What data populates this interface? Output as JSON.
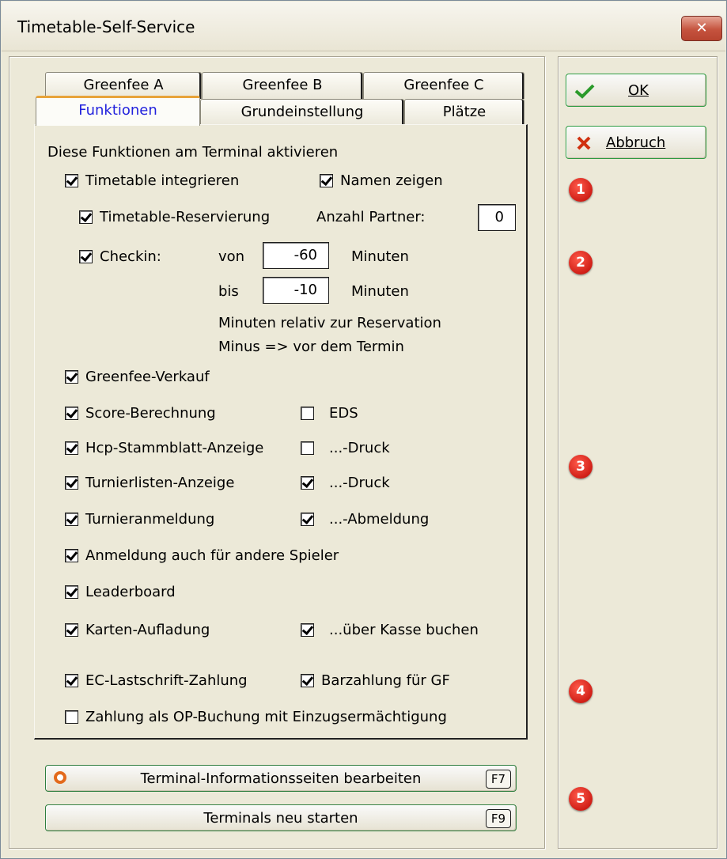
{
  "window": {
    "title": "Timetable-Self-Service",
    "close_icon": "close-icon"
  },
  "tabs": {
    "row1": [
      "Greenfee A",
      "Greenfee B",
      "Greenfee C"
    ],
    "row2": [
      "Funktionen",
      "Grundeinstellung",
      "Plätze"
    ],
    "active": "Funktionen"
  },
  "buttons": {
    "ok": "OK",
    "cancel": "Abbruch"
  },
  "functions": {
    "heading": "Diese Funktionen am Terminal aktivieren",
    "timetable_integrate": {
      "label": "Timetable integrieren",
      "checked": true
    },
    "show_names": {
      "label": "Namen zeigen",
      "checked": true
    },
    "timetable_reservation": {
      "label": "Timetable-Reservierung",
      "checked": true
    },
    "partner_count": {
      "label": "Anzahl Partner:",
      "value": "0"
    },
    "checkin": {
      "label": "Checkin:",
      "checked": true
    },
    "from": {
      "label": "von",
      "value": "-60",
      "unit": "Minuten"
    },
    "to": {
      "label": "bis",
      "value": "-10",
      "unit": "Minuten"
    },
    "note_line1": "Minuten relativ zur Reservation",
    "note_line2": "Minus => vor dem Termin",
    "greenfee_sale": {
      "label": "Greenfee-Verkauf",
      "checked": true
    },
    "score_calc": {
      "label": "Score-Berechnung",
      "checked": true
    },
    "eds": {
      "label": "EDS",
      "checked": false
    },
    "hcp_display": {
      "label": "Hcp-Stammblatt-Anzeige",
      "checked": true
    },
    "hcp_print": {
      "label": "...-Druck",
      "checked": false
    },
    "tournament_lists": {
      "label": "Turnierlisten-Anzeige",
      "checked": true
    },
    "tournament_print": {
      "label": "...-Druck",
      "checked": true
    },
    "tournament_signup": {
      "label": "Turnieranmeldung",
      "checked": true
    },
    "tournament_signoff": {
      "label": "...-Abmeldung",
      "checked": true
    },
    "signup_others": {
      "label": "Anmeldung auch für andere Spieler",
      "checked": true
    },
    "leaderboard": {
      "label": "Leaderboard",
      "checked": true
    },
    "card_topup": {
      "label": "Karten-Aufladung",
      "checked": true
    },
    "via_cash": {
      "label": "...über Kasse buchen",
      "checked": true
    },
    "ec_debit": {
      "label": "EC-Lastschrift-Zahlung",
      "checked": true
    },
    "cash_gf": {
      "label": "Barzahlung für GF",
      "checked": true
    },
    "op_booking": {
      "label": "Zahlung als OP-Buchung mit Einzugsermächtigung",
      "checked": false
    }
  },
  "bottom": {
    "info_pages": {
      "label": "Terminal-Informationsseiten bearbeiten",
      "key": "F7"
    },
    "restart": {
      "label": "Terminals neu starten",
      "key": "F9"
    }
  },
  "badges": [
    "1",
    "2",
    "3",
    "4",
    "5"
  ],
  "colors": {
    "active_tab_text": "#2222dd",
    "badge": "#d01f17",
    "check_green": "#2a9a2a",
    "cancel_red": "#d03010"
  }
}
